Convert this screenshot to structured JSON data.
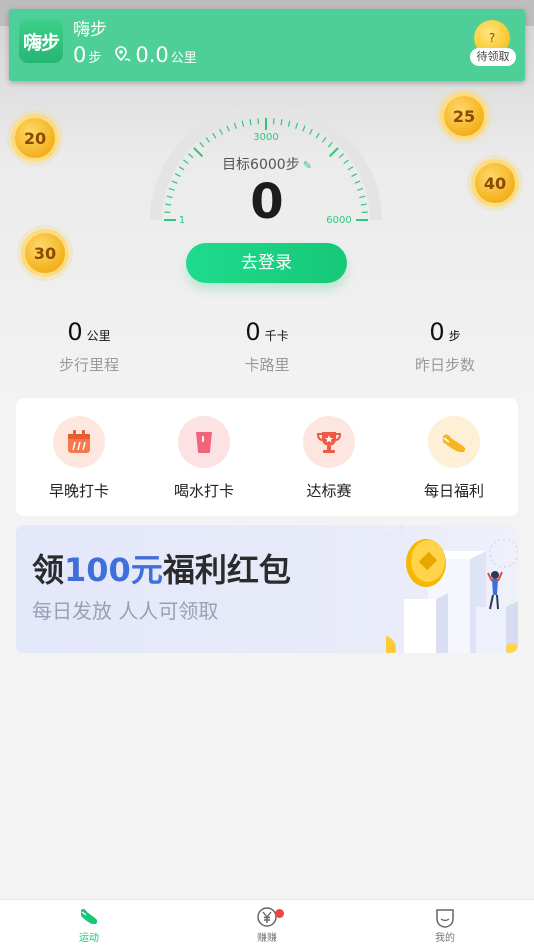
{
  "notification": {
    "app_icon_text": "嗨步",
    "title": "嗨步",
    "steps": "0",
    "steps_unit": "步",
    "distance": "0.0",
    "distance_unit": "公里",
    "coin_mark": "?",
    "pending_label": "待领取"
  },
  "coins": [
    "20",
    "25",
    "40",
    "30"
  ],
  "gauge": {
    "tick_min": "1",
    "tick_mid": "3000",
    "tick_max": "6000",
    "goal_label": "目标6000步",
    "steps": "0"
  },
  "login_button": "去登录",
  "stats": [
    {
      "value": "0",
      "unit": "公里",
      "label": "步行里程"
    },
    {
      "value": "0",
      "unit": "千卡",
      "label": "卡路里"
    },
    {
      "value": "0",
      "unit": "步",
      "label": "昨日步数"
    }
  ],
  "features": [
    {
      "label": "早晚打卡",
      "icon": "calendar-icon",
      "bg": "#fde7df",
      "color": "#f47a4e"
    },
    {
      "label": "喝水打卡",
      "icon": "cup-icon",
      "bg": "#fde2e4",
      "color": "#f2647a"
    },
    {
      "label": "达标赛",
      "icon": "trophy-icon",
      "bg": "#fde5e0",
      "color": "#ee5a45"
    },
    {
      "label": "每日福利",
      "icon": "shoe-icon",
      "bg": "#fdf0d6",
      "color": "#f5b623"
    }
  ],
  "banner": {
    "title_pre": "领",
    "title_highlight": "100元",
    "title_post": "福利红包",
    "subtitle": "每日发放 人人可领取"
  },
  "tabs": [
    {
      "label": "运动",
      "icon": "shoe-icon",
      "active": true
    },
    {
      "label": "赚赚",
      "icon": "yen-coin-icon",
      "active": false
    },
    {
      "label": "我的",
      "icon": "face-icon",
      "active": false
    }
  ],
  "colors": {
    "primary": "#16c878",
    "accent_blue": "#3f6fdb",
    "coin": "#f3b11c"
  }
}
